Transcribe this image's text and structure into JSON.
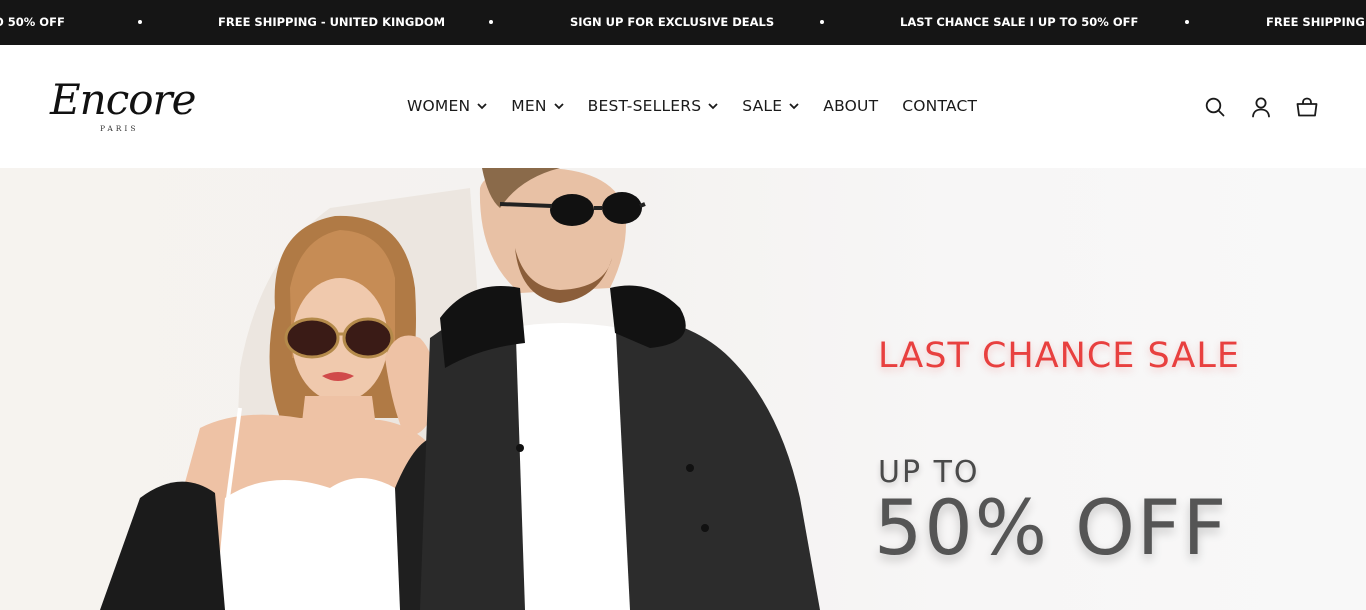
{
  "announcement": {
    "items": [
      "O 50% OFF",
      "FREE SHIPPING - UNITED KINGDOM",
      "SIGN UP FOR EXCLUSIVE DEALS",
      "LAST CHANCE SALE I UP TO 50% OFF",
      "FREE SHIPPING - UNITED KINGDOM"
    ]
  },
  "header": {
    "logo": {
      "script": "Encore",
      "sub": "PARIS"
    },
    "nav": [
      {
        "label": "WOMEN",
        "has_dropdown": true
      },
      {
        "label": "MEN",
        "has_dropdown": true
      },
      {
        "label": "BEST-SELLERS",
        "has_dropdown": true
      },
      {
        "label": "SALE",
        "has_dropdown": true
      },
      {
        "label": "ABOUT",
        "has_dropdown": false
      },
      {
        "label": "CONTACT",
        "has_dropdown": false
      }
    ],
    "icons": [
      "search-icon",
      "account-icon",
      "cart-icon"
    ]
  },
  "hero": {
    "title": "LAST CHANCE SALE",
    "line1": "UP TO",
    "line2": "50% OFF",
    "colors": {
      "title": "#e8403f",
      "offer": "#555555"
    }
  },
  "colors": {
    "announce_bg": "#151515",
    "announce_text": "#ffffff",
    "nav_text": "#1a1a1a"
  }
}
